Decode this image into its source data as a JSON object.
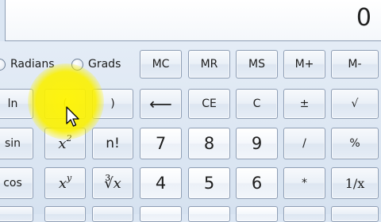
{
  "display": {
    "value": "0"
  },
  "mode": {
    "radians_label": "Radians",
    "grads_label": "Grads"
  },
  "memory": [
    "MC",
    "MR",
    "MS",
    "M+",
    "M-"
  ],
  "row1": {
    "ln": "ln",
    "open_paren": "(",
    "close_paren": ")",
    "backspace": "⟵",
    "ce": "CE",
    "c": "C",
    "plus_minus": "±",
    "sqrt": "√"
  },
  "row2": {
    "sin": "sin",
    "square_base": "x",
    "square_exp": "2",
    "factorial": "n!",
    "seven": "7",
    "eight": "8",
    "nine": "9",
    "divide": "/",
    "percent": "%"
  },
  "row3": {
    "cos": "cos",
    "power_base": "x",
    "power_exp": "y",
    "root_label": "∛x",
    "four": "4",
    "five": "5",
    "six": "6",
    "multiply": "*",
    "reciprocal": "1/x"
  },
  "colors": {
    "highlight": "#f5ec00",
    "button_border": "#8d9db4",
    "background": "#dbe6f3"
  },
  "icons": {
    "cursor": "mouse-pointer-icon",
    "backspace": "backspace-arrow-icon"
  }
}
